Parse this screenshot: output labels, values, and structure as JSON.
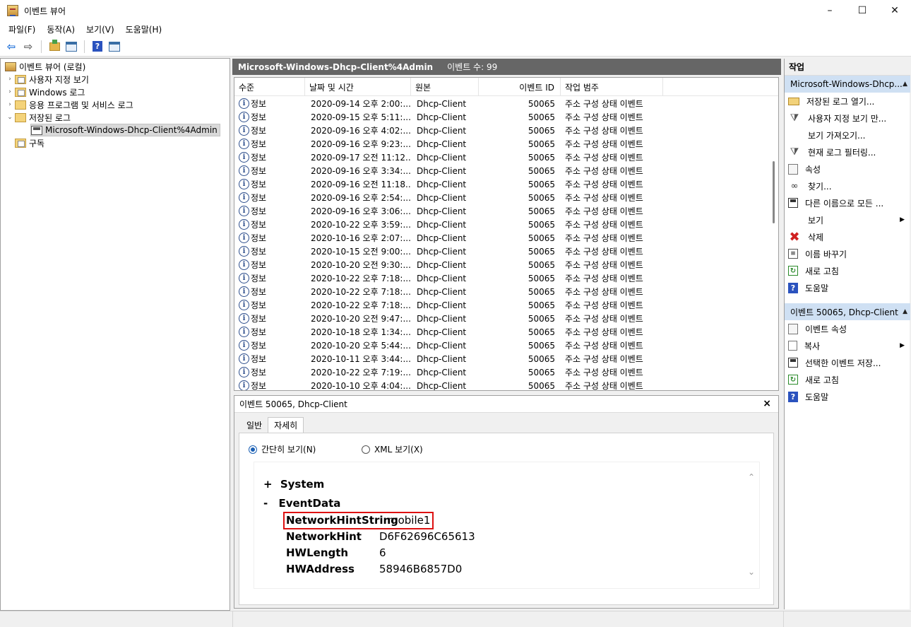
{
  "window": {
    "title": "이벤트 뷰어",
    "minimize": "–",
    "maximize": "☐",
    "close": "✕"
  },
  "menu": [
    "파일(F)",
    "동작(A)",
    "보기(V)",
    "도움말(H)"
  ],
  "tree": {
    "root": "이벤트 뷰어 (로컬)",
    "items": [
      "사용자 지정 보기",
      "Windows 로그",
      "응용 프로그램 및 서비스 로그",
      "저장된 로그"
    ],
    "selected": "Microsoft-Windows-Dhcp-Client%4Admin",
    "subscriptions": "구독"
  },
  "list_header": {
    "title": "Microsoft-Windows-Dhcp-Client%4Admin",
    "count": "이벤트 수: 99"
  },
  "columns": [
    "수준",
    "날짜 및 시간",
    "원본",
    "이벤트 ID",
    "작업 범주"
  ],
  "rows": [
    [
      "정보",
      "2020-09-14 오후 2:00:...",
      "Dhcp-Client",
      "50065",
      "주소 구성 상태 이벤트"
    ],
    [
      "정보",
      "2020-09-15 오후 5:11:...",
      "Dhcp-Client",
      "50065",
      "주소 구성 상태 이벤트"
    ],
    [
      "정보",
      "2020-09-16 오후 4:02:...",
      "Dhcp-Client",
      "50065",
      "주소 구성 상태 이벤트"
    ],
    [
      "정보",
      "2020-09-16 오후 9:23:...",
      "Dhcp-Client",
      "50065",
      "주소 구성 상태 이벤트"
    ],
    [
      "정보",
      "2020-09-17 오전 11:12...",
      "Dhcp-Client",
      "50065",
      "주소 구성 상태 이벤트"
    ],
    [
      "정보",
      "2020-09-16 오후 3:34:...",
      "Dhcp-Client",
      "50065",
      "주소 구성 상태 이벤트"
    ],
    [
      "정보",
      "2020-09-16 오전 11:18...",
      "Dhcp-Client",
      "50065",
      "주소 구성 상태 이벤트"
    ],
    [
      "정보",
      "2020-09-16 오후 2:54:...",
      "Dhcp-Client",
      "50065",
      "주소 구성 상태 이벤트"
    ],
    [
      "정보",
      "2020-09-16 오후 3:06:...",
      "Dhcp-Client",
      "50065",
      "주소 구성 상태 이벤트"
    ],
    [
      "정보",
      "2020-10-22 오후 3:59:...",
      "Dhcp-Client",
      "50065",
      "주소 구성 상태 이벤트"
    ],
    [
      "정보",
      "2020-10-16 오후 2:07:...",
      "Dhcp-Client",
      "50065",
      "주소 구성 상태 이벤트"
    ],
    [
      "정보",
      "2020-10-15 오전 9:00:...",
      "Dhcp-Client",
      "50065",
      "주소 구성 상태 이벤트"
    ],
    [
      "정보",
      "2020-10-20 오전 9:30:...",
      "Dhcp-Client",
      "50065",
      "주소 구성 상태 이벤트"
    ],
    [
      "정보",
      "2020-10-22 오후 7:18:...",
      "Dhcp-Client",
      "50065",
      "주소 구성 상태 이벤트"
    ],
    [
      "정보",
      "2020-10-22 오후 7:18:...",
      "Dhcp-Client",
      "50065",
      "주소 구성 상태 이벤트"
    ],
    [
      "정보",
      "2020-10-22 오후 7:18:...",
      "Dhcp-Client",
      "50065",
      "주소 구성 상태 이벤트"
    ],
    [
      "정보",
      "2020-10-20 오전 9:47:...",
      "Dhcp-Client",
      "50065",
      "주소 구성 상태 이벤트"
    ],
    [
      "정보",
      "2020-10-18 오후 1:34:...",
      "Dhcp-Client",
      "50065",
      "주소 구성 상태 이벤트"
    ],
    [
      "정보",
      "2020-10-20 오후 5:44:...",
      "Dhcp-Client",
      "50065",
      "주소 구성 상태 이벤트"
    ],
    [
      "정보",
      "2020-10-11 오후 3:44:...",
      "Dhcp-Client",
      "50065",
      "주소 구성 상태 이벤트"
    ],
    [
      "정보",
      "2020-10-22 오후 7:19:...",
      "Dhcp-Client",
      "50065",
      "주소 구성 상태 이벤트"
    ],
    [
      "정보",
      "2020-10-10 오후 4:04:...",
      "Dhcp-Client",
      "50065",
      "주소 구성 상태 이벤트"
    ]
  ],
  "detail": {
    "title": "이벤트 50065, Dhcp-Client",
    "close": "×",
    "tabs": [
      "일반",
      "자세히"
    ],
    "radio_friendly": "간단히 보기(N)",
    "radio_xml": "XML 보기(X)",
    "system_toggle": "+",
    "system": "System",
    "eventdata_toggle": "-",
    "eventdata": "EventData",
    "fields": [
      {
        "k": "NetworkHintString",
        "v": "mobile1"
      },
      {
        "k": "NetworkHint",
        "v": "D6F62696C65613"
      },
      {
        "k": "HWLength",
        "v": "6"
      },
      {
        "k": "HWAddress",
        "v": "58946B6857D0"
      }
    ],
    "highlight_color": "#dd1111"
  },
  "actions": {
    "header": "작업",
    "section1": "Microsoft-Windows-Dhcp...",
    "items1": [
      "저장된 로그 열기...",
      "사용자 지정 보기 만...",
      "보기 가져오기...",
      "현재 로그 필터링...",
      "속성",
      "찾기...",
      "다른 이름으로 모든 ...",
      "보기",
      "삭제",
      "이름 바꾸기",
      "새로 고침",
      "도움말"
    ],
    "section2": "이벤트 50065, Dhcp-Client",
    "items2": [
      "이벤트 속성",
      "복사",
      "선택한 이벤트 저장...",
      "새로 고침",
      "도움말"
    ]
  }
}
